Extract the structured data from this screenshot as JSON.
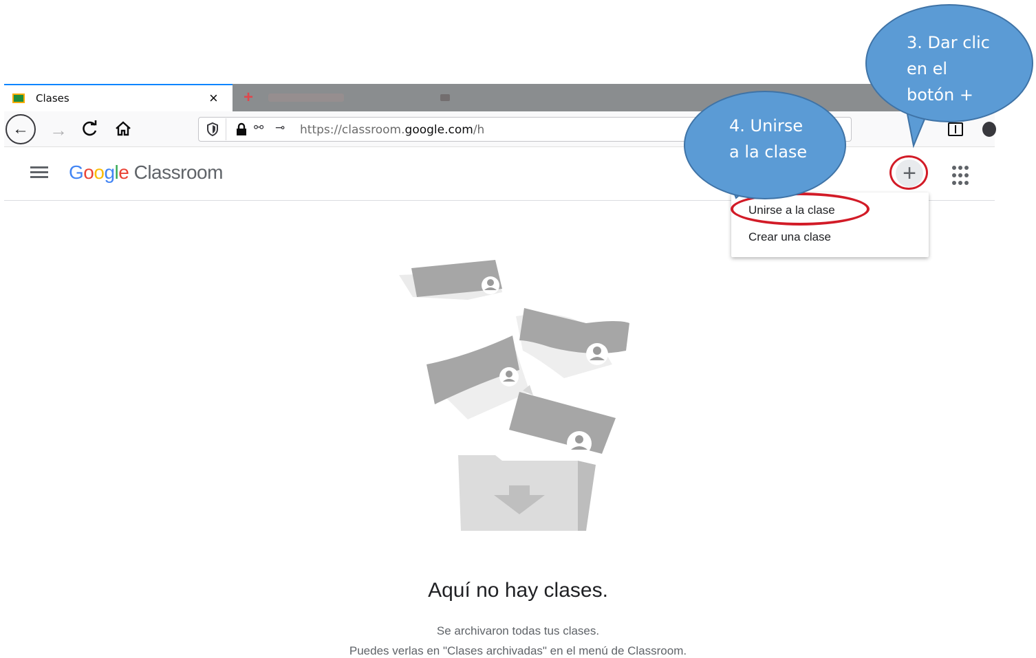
{
  "browser": {
    "tab_title": "Clases",
    "tab_close": "×",
    "new_tab": "+",
    "url_prefix": "https://classroom.",
    "url_domain": "google.com",
    "url_suffix": "/h"
  },
  "header": {
    "logo_letters": [
      "G",
      "o",
      "o",
      "g",
      "l",
      "e"
    ],
    "logo_colors": [
      "#4285f4",
      "#ea4335",
      "#fbbc05",
      "#4285f4",
      "#34a853",
      "#ea4335"
    ],
    "app_name": "Classroom",
    "plus_label": "+"
  },
  "menu": {
    "items": [
      {
        "label": "Unirse a la clase"
      },
      {
        "label": "Crear una clase"
      }
    ]
  },
  "callouts": {
    "step3": [
      "3. Dar clic",
      "en el",
      "botón +"
    ],
    "step4": [
      "4. Unirse",
      "a la clase"
    ],
    "fill": "#5b9bd5",
    "highlight": "#d21b27"
  },
  "empty_state": {
    "title": "Aquí no hay clases.",
    "line1": "Se archivaron todas tus clases.",
    "line2": "Puedes verlas en \"Clases archivadas\" en el menú de Classroom."
  }
}
